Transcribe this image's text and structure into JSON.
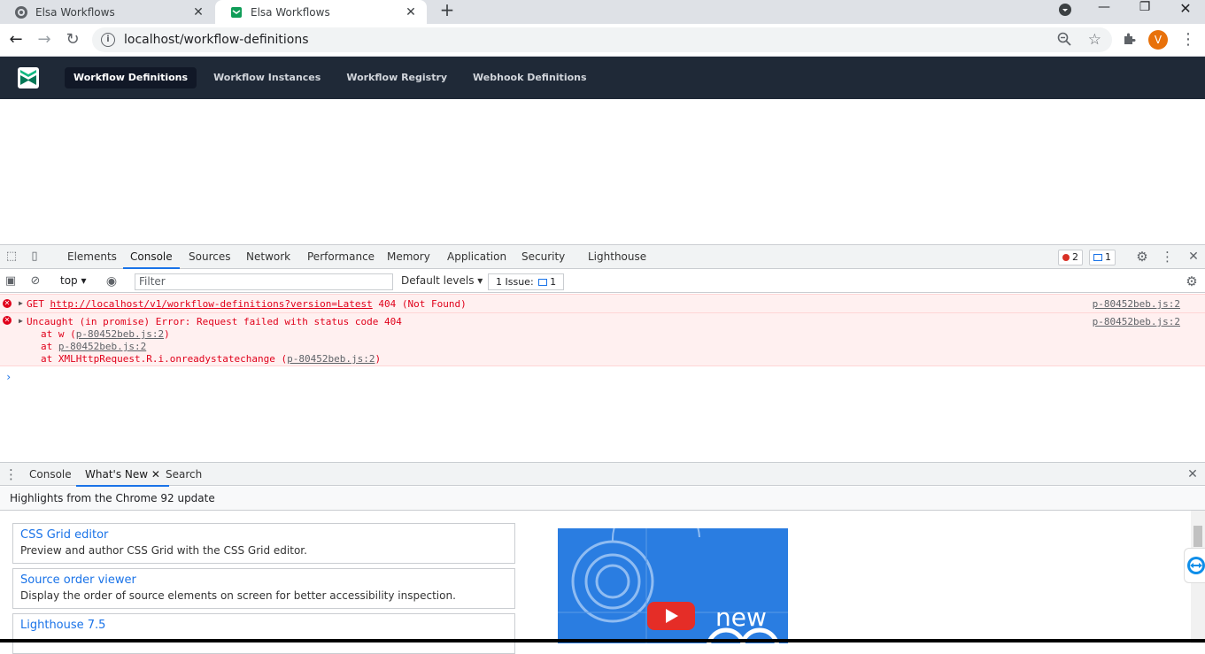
{
  "browser": {
    "tabs": [
      {
        "title": "Elsa Workflows",
        "active": false
      },
      {
        "title": "Elsa Workflows",
        "active": true
      }
    ],
    "url": "localhost/workflow-definitions",
    "avatar_letter": "V"
  },
  "app": {
    "nav": [
      {
        "label": "Workflow Definitions",
        "active": true
      },
      {
        "label": "Workflow Instances",
        "active": false
      },
      {
        "label": "Workflow Registry",
        "active": false
      },
      {
        "label": "Webhook Definitions",
        "active": false
      }
    ]
  },
  "devtools": {
    "tabs": [
      "Elements",
      "Console",
      "Sources",
      "Network",
      "Performance",
      "Memory",
      "Application",
      "Security",
      "Lighthouse"
    ],
    "active_tab": "Console",
    "error_count": "2",
    "message_count": "1",
    "toolbar": {
      "context": "top",
      "filter_placeholder": "Filter",
      "levels": "Default levels",
      "issues_label": "1 Issue:",
      "issues_count": "1"
    },
    "console": {
      "entries": [
        {
          "method": "GET",
          "url": "http://localhost/v1/workflow-definitions?version=Latest",
          "status": "404 (Not Found)",
          "source": "p-80452beb.js:2"
        },
        {
          "message": "Uncaught (in promise) Error: Request failed with status code 404",
          "source": "p-80452beb.js:2",
          "stack": [
            {
              "prefix": "at w (",
              "link": "p-80452beb.js:2",
              "suffix": ")"
            },
            {
              "prefix": "at ",
              "link": "p-80452beb.js:2",
              "suffix": ""
            },
            {
              "prefix": "at XMLHttpRequest.R.i.onreadystatechange (",
              "link": "p-80452beb.js:2",
              "suffix": ")"
            }
          ]
        }
      ],
      "prompt": "›"
    },
    "drawer": {
      "tabs": [
        "Console",
        "What's New",
        "Search"
      ],
      "active_tab": "What's New",
      "highlight": "Highlights from the Chrome 92 update",
      "cards": [
        {
          "title": "CSS Grid editor",
          "desc": "Preview and author CSS Grid with the CSS Grid editor."
        },
        {
          "title": "Source order viewer",
          "desc": "Display the order of source elements on screen for better accessibility inspection."
        },
        {
          "title": "Lighthouse 7.5",
          "desc": ""
        }
      ],
      "video_text": "new"
    }
  },
  "colors": {
    "app_header": "#1f2937",
    "accent": "#1a73e8",
    "error": "#e0001a",
    "error_bg": "#fff0f0"
  }
}
